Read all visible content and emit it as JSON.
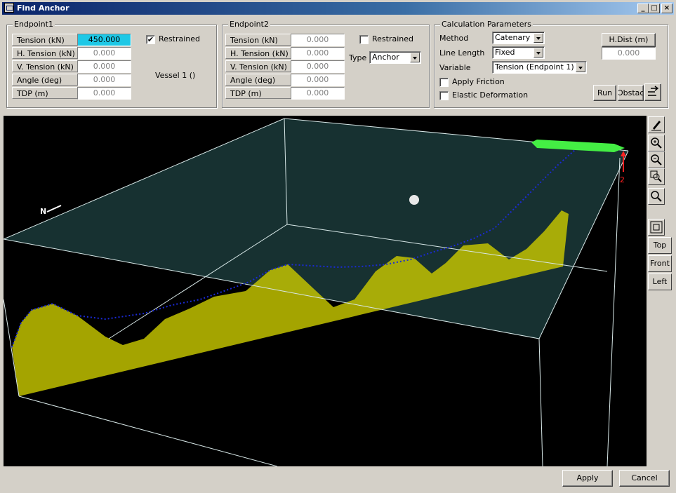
{
  "window": {
    "title": "Find Anchor"
  },
  "endpoint1": {
    "group_title": "Endpoint1",
    "rows": [
      {
        "label": "Tension (kN)",
        "value": "450.000"
      },
      {
        "label": "H. Tension (kN)",
        "value": "0.000"
      },
      {
        "label": "V. Tension (kN)",
        "value": "0.000"
      },
      {
        "label": "Angle (deg)",
        "value": "0.000"
      },
      {
        "label": "TDP (m)",
        "value": "0.000"
      }
    ],
    "restrained_label": "Restrained",
    "restrained_checked": true,
    "vessel_label": "Vessel 1 ()"
  },
  "endpoint2": {
    "group_title": "Endpoint2",
    "rows": [
      {
        "label": "Tension (kN)",
        "value": "0.000"
      },
      {
        "label": "H. Tension (kN)",
        "value": "0.000"
      },
      {
        "label": "V. Tension (kN)",
        "value": "0.000"
      },
      {
        "label": "Angle (deg)",
        "value": "0.000"
      },
      {
        "label": "TDP (m)",
        "value": "0.000"
      }
    ],
    "restrained_label": "Restrained",
    "restrained_checked": false,
    "type_label": "Type",
    "type_value": "Anchor"
  },
  "calc": {
    "group_title": "Calculation Parameters",
    "method_label": "Method",
    "method_value": "Catenary",
    "line_length_label": "Line Length",
    "line_length_value": "Fixed",
    "variable_label": "Variable",
    "variable_value": "Tension (Endpoint 1)",
    "hdist_label": "H.Dist (m)",
    "hdist_value": "0.000",
    "apply_friction_label": "Apply Friction",
    "elastic_label": "Elastic Deformation",
    "run_label": "Run",
    "obstacle_label": "Obstacle"
  },
  "viewport": {
    "north_label": "N",
    "endpoint_marker": "2",
    "colors": {
      "seabed": "#c8c800",
      "water": "#2a5a5a",
      "line": "#1a2ad8",
      "vessel": "#44ee44",
      "marker": "#ff2222"
    }
  },
  "side_toolbar": {
    "top": "Top",
    "front": "Front",
    "left": "Left"
  },
  "footer": {
    "apply": "Apply",
    "cancel": "Cancel"
  }
}
